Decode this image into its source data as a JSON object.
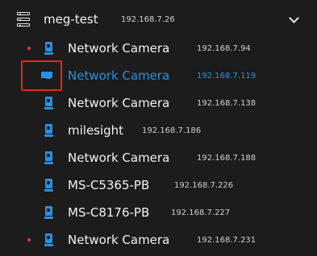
{
  "group": {
    "name": "meg-test",
    "ip": "192.168.7.26",
    "icon": "server-icon",
    "expand_icon": "chevron-down-icon"
  },
  "devices": [
    {
      "name": "Network Camera",
      "ip": "192.168.7.94",
      "recording": true,
      "selected": false,
      "icon": "camera-icon"
    },
    {
      "name": "Network Camera",
      "ip": "192.168.7.119",
      "recording": false,
      "selected": true,
      "icon": "bullet-camera-icon"
    },
    {
      "name": "Network Camera",
      "ip": "192.168.7.138",
      "recording": false,
      "selected": false,
      "icon": "camera-icon"
    },
    {
      "name": "milesight",
      "ip": "192.168.7.186",
      "recording": false,
      "selected": false,
      "icon": "camera-icon"
    },
    {
      "name": "Network Camera",
      "ip": "192.168.7.188",
      "recording": false,
      "selected": false,
      "icon": "camera-icon"
    },
    {
      "name": "MS-C5365-PB",
      "ip": "192.168.7.226",
      "recording": false,
      "selected": false,
      "icon": "camera-icon"
    },
    {
      "name": "MS-C8176-PB",
      "ip": "192.168.7.227",
      "recording": false,
      "selected": false,
      "icon": "camera-icon"
    },
    {
      "name": "Network Camera",
      "ip": "192.168.7.231",
      "recording": true,
      "selected": false,
      "icon": "camera-icon"
    }
  ],
  "colors": {
    "accent": "#2b8fe0",
    "recording": "#e23b2e",
    "highlight_box": "#e0291b",
    "background": "#1c1c1c"
  }
}
